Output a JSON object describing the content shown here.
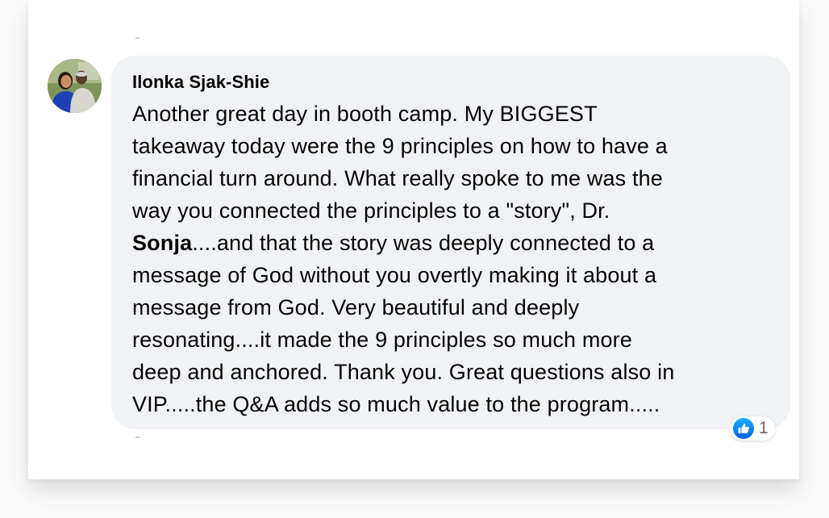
{
  "comment": {
    "author": "Ilonka Sjak-Shie",
    "lines": [
      "Another great day in booth camp. My BIGGEST",
      "takeaway today were the 9 principles on how to have a",
      "financial turn around. What really spoke to me was the",
      "way you connected the principles to a \"story\", Dr."
    ],
    "mention": "Sonja",
    "mention_rest": "....and that the story was deeply connected to a",
    "lines_after": [
      "message of God without you overtly making it about a",
      "message from God. Very beautiful and deeply",
      "resonating....it made the 9 principles so much more",
      "deep and anchored. Thank you. Great questions also in",
      "VIP.....the Q&A adds so much value to the program....."
    ],
    "reactions": {
      "icon": "like-icon",
      "count": "1"
    }
  },
  "colors": {
    "bubble_bg": "#f0f2f5",
    "text": "#050505",
    "like_blue": "#1877f2",
    "meta_gray": "#65676b"
  }
}
